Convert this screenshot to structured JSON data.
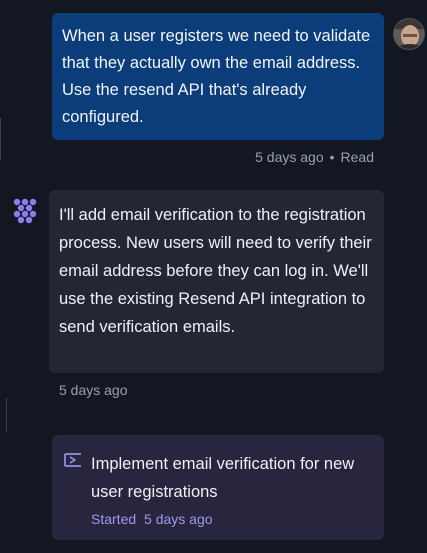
{
  "user_message": {
    "text": "When a user registers we need to validate that they actually own the email address. Use the resend API that's already configured.",
    "time": "5 days ago",
    "separator": "•",
    "status": "Read"
  },
  "assistant_message": {
    "text": "I'll add email verification to the registration process. New users will need to verify their email address before they can log in. We'll use the existing Resend API integration to send verification emails.",
    "time": "5 days ago"
  },
  "task": {
    "title": "Implement email verification for new user registrations",
    "status_label": "Started",
    "status_time": "5 days ago",
    "accent_color": "#9f98f0"
  },
  "icons": {
    "assistant": "assistant-logo-icon",
    "task": "task-flag-icon",
    "user": "user-avatar"
  },
  "colors": {
    "background": "#131722",
    "user_bubble": "#0b3d7a",
    "assistant_bubble": "#232733",
    "task_card": "#28253f"
  }
}
